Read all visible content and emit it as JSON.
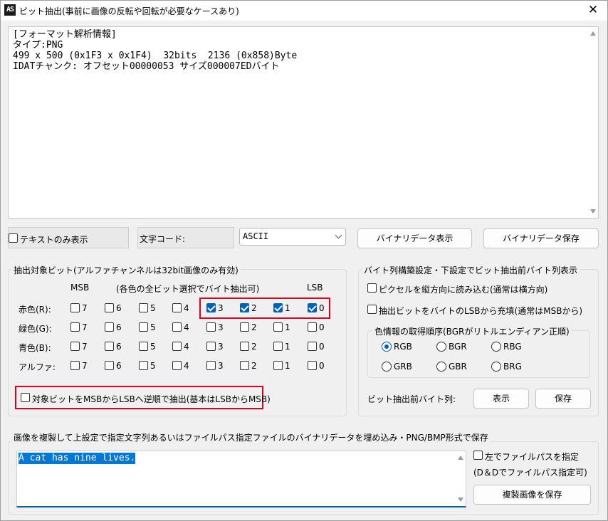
{
  "window": {
    "app_icon": "AS",
    "title": "ビット抽出(事前に画像の反転や回転が必要なケースあり)",
    "close_glyph": "✕"
  },
  "info": {
    "lines": [
      "[フォーマット解析情報]",
      "タイプ:PNG",
      "499 x 500 (0x1F3 x 0x1F4)  32bits  2136 (0x858)Byte",
      "IDATチャンク: オフセット00000053 サイズ000007EDバイト"
    ]
  },
  "toolbar": {
    "text_only_label": "テキストのみ表示",
    "text_only_checked": false,
    "char_code_label": "文字コード:",
    "char_code_value": "ASCII",
    "binary_show_button": "バイナリデータ表示",
    "binary_save_button": "バイナリデータ保存"
  },
  "extract": {
    "group_title": "抽出対象ビット(アルファチャンネルは32bit画像のみ有効)",
    "msb_label": "MSB",
    "hint": "(各色の全ビット選択でバイト抽出可)",
    "lsb_label": "LSB",
    "bit_labels": [
      "7",
      "6",
      "5",
      "4",
      "3",
      "2",
      "1",
      "0"
    ],
    "rows": [
      {
        "label": "赤色(R):",
        "checked": [
          false,
          false,
          false,
          false,
          true,
          true,
          true,
          true
        ]
      },
      {
        "label": "緑色(G):",
        "checked": [
          false,
          false,
          false,
          false,
          false,
          false,
          false,
          false
        ]
      },
      {
        "label": "青色(B):",
        "checked": [
          false,
          false,
          false,
          false,
          false,
          false,
          false,
          false
        ]
      },
      {
        "label": "アルファ:",
        "checked": [
          false,
          false,
          false,
          false,
          false,
          false,
          false,
          false
        ]
      }
    ],
    "reverse_label": "対象ビットをMSBからLSBへ逆順で抽出(基本はLSBからMSB)",
    "reverse_checked": false,
    "highlight_color": "#e0001b"
  },
  "byte": {
    "group_title": "バイト列構築設定・下設定でビット抽出前バイト列表示",
    "vertical_label": "ピクセルを縦方向に読み込む(通常は横方向)",
    "vertical_checked": false,
    "fill_label": "抽出ビットをバイトのLSBから充填(通常はMSBから)",
    "fill_checked": false,
    "order_title": "色情報の取得順序(BGRがリトルエンディアン正順)",
    "orders": [
      "RGB",
      "BGR",
      "RBG",
      "GRB",
      "GBR",
      "BRG"
    ],
    "selected_order": "RGB",
    "pre_label": "ビット抽出前バイト列:",
    "show_button": "表示",
    "save_button": "保存"
  },
  "embed": {
    "group_title": "画像を複製して上設定で指定文字列あるいはファイルパス指定ファイルのバイナリデータを埋め込み・PNG/BMP形式で保存",
    "text": "A cat has nine lives.",
    "filepath_label": "左でファイルパスを指定",
    "filepath_checked": false,
    "dnd_note": "(D＆Dでファイルパス指定可)",
    "save_button": "複製画像を保存"
  },
  "colors": {
    "accent": "#005fb8",
    "selection": "#0078d7",
    "highlight": "#e0001b"
  }
}
